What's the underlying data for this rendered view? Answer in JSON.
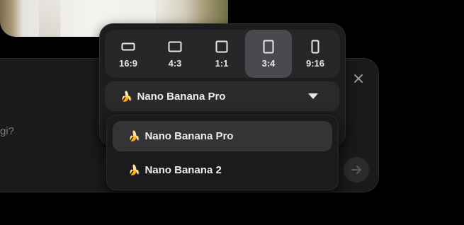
{
  "prompt": {
    "partial_text": "gi?",
    "close_icon": "close-icon",
    "send_icon": "arrow-right-icon"
  },
  "aspect_ratios": {
    "selected": "3:4",
    "options": [
      {
        "label": "16:9",
        "icon": "aspect-16-9-icon"
      },
      {
        "label": "4:3",
        "icon": "aspect-4-3-icon"
      },
      {
        "label": "1:1",
        "icon": "aspect-1-1-icon"
      },
      {
        "label": "3:4",
        "icon": "aspect-3-4-icon"
      },
      {
        "label": "9:16",
        "icon": "aspect-9-16-icon"
      }
    ]
  },
  "model_select": {
    "emoji": "🍌",
    "value": "Nano Banana Pro",
    "icon": "chevron-down-icon"
  },
  "model_dropdown": {
    "items": [
      {
        "emoji": "🍌",
        "label": "Nano Banana Pro"
      },
      {
        "emoji": "🍌",
        "label": "Nano Banana 2"
      }
    ]
  },
  "colors": {
    "background": "#000000",
    "panel": "#1a1a1c",
    "popup": "#1d1d1f",
    "selected_ratio": "#4a4a4e",
    "text": "#e8e8e8"
  }
}
